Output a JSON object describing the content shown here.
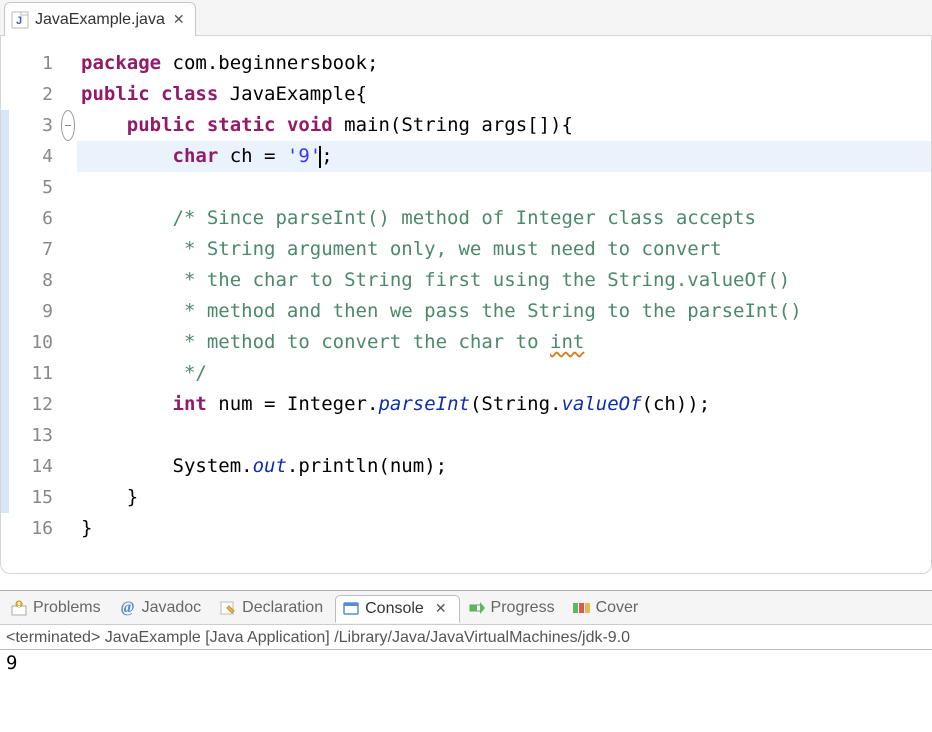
{
  "tab": {
    "filename": "JavaExample.java"
  },
  "code": {
    "lines": [
      {
        "n": 1,
        "strip": false,
        "fold": "",
        "segs": [
          [
            "kw",
            "package"
          ],
          [
            "normal",
            " com.beginnersbook;"
          ]
        ]
      },
      {
        "n": 2,
        "strip": false,
        "fold": "",
        "segs": [
          [
            "kw",
            "public"
          ],
          [
            "normal",
            " "
          ],
          [
            "kw",
            "class"
          ],
          [
            "normal",
            " JavaExample{"
          ]
        ]
      },
      {
        "n": 3,
        "strip": true,
        "fold": "minus",
        "segs": [
          [
            "normal",
            "    "
          ],
          [
            "kw",
            "public"
          ],
          [
            "normal",
            " "
          ],
          [
            "kw",
            "static"
          ],
          [
            "normal",
            " "
          ],
          [
            "kw",
            "void"
          ],
          [
            "normal",
            " main(String args[]){"
          ]
        ]
      },
      {
        "n": 4,
        "strip": true,
        "fold": "",
        "hl": true,
        "segs": [
          [
            "normal",
            "        "
          ],
          [
            "kw",
            "char"
          ],
          [
            "normal",
            " ch = "
          ],
          [
            "str",
            "'9'"
          ],
          [
            "cursor",
            ""
          ],
          [
            "normal",
            ";"
          ]
        ]
      },
      {
        "n": 5,
        "strip": true,
        "fold": "",
        "segs": []
      },
      {
        "n": 6,
        "strip": true,
        "fold": "",
        "segs": [
          [
            "normal",
            "        "
          ],
          [
            "comment",
            "/* Since parseInt() method of Integer class accepts"
          ]
        ]
      },
      {
        "n": 7,
        "strip": true,
        "fold": "",
        "segs": [
          [
            "normal",
            "        "
          ],
          [
            "comment",
            " * String argument only, we must need to convert"
          ]
        ]
      },
      {
        "n": 8,
        "strip": true,
        "fold": "",
        "segs": [
          [
            "normal",
            "        "
          ],
          [
            "comment",
            " * the char to String first using the String.valueOf()"
          ]
        ]
      },
      {
        "n": 9,
        "strip": true,
        "fold": "",
        "segs": [
          [
            "normal",
            "        "
          ],
          [
            "comment",
            " * method and then we pass the String to the parseInt()"
          ]
        ]
      },
      {
        "n": 10,
        "strip": true,
        "fold": "",
        "segs": [
          [
            "normal",
            "        "
          ],
          [
            "comment",
            " * method to convert the char to "
          ],
          [
            "comment warn-under",
            "int"
          ]
        ]
      },
      {
        "n": 11,
        "strip": true,
        "fold": "",
        "segs": [
          [
            "normal",
            "        "
          ],
          [
            "comment",
            " */"
          ]
        ]
      },
      {
        "n": 12,
        "strip": true,
        "fold": "",
        "segs": [
          [
            "normal",
            "        "
          ],
          [
            "kw",
            "int"
          ],
          [
            "normal",
            " num = Integer."
          ],
          [
            "static-i",
            "parseInt"
          ],
          [
            "normal",
            "(String."
          ],
          [
            "static-i",
            "valueOf"
          ],
          [
            "normal",
            "(ch));"
          ]
        ]
      },
      {
        "n": 13,
        "strip": true,
        "fold": "",
        "segs": []
      },
      {
        "n": 14,
        "strip": true,
        "fold": "",
        "segs": [
          [
            "normal",
            "        System."
          ],
          [
            "static-i",
            "out"
          ],
          [
            "normal",
            ".println(num);"
          ]
        ]
      },
      {
        "n": 15,
        "strip": true,
        "fold": "",
        "segs": [
          [
            "normal",
            "    }"
          ]
        ]
      },
      {
        "n": 16,
        "strip": false,
        "fold": "",
        "segs": [
          [
            "normal",
            "}"
          ]
        ]
      }
    ]
  },
  "views": {
    "problems": "Problems",
    "javadoc": "Javadoc",
    "declaration": "Declaration",
    "console": "Console",
    "progress": "Progress",
    "coverage": "Cover"
  },
  "console": {
    "terminated": "<terminated> JavaExample [Java Application] /Library/Java/JavaVirtualMachines/jdk-9.0",
    "output": "9"
  }
}
